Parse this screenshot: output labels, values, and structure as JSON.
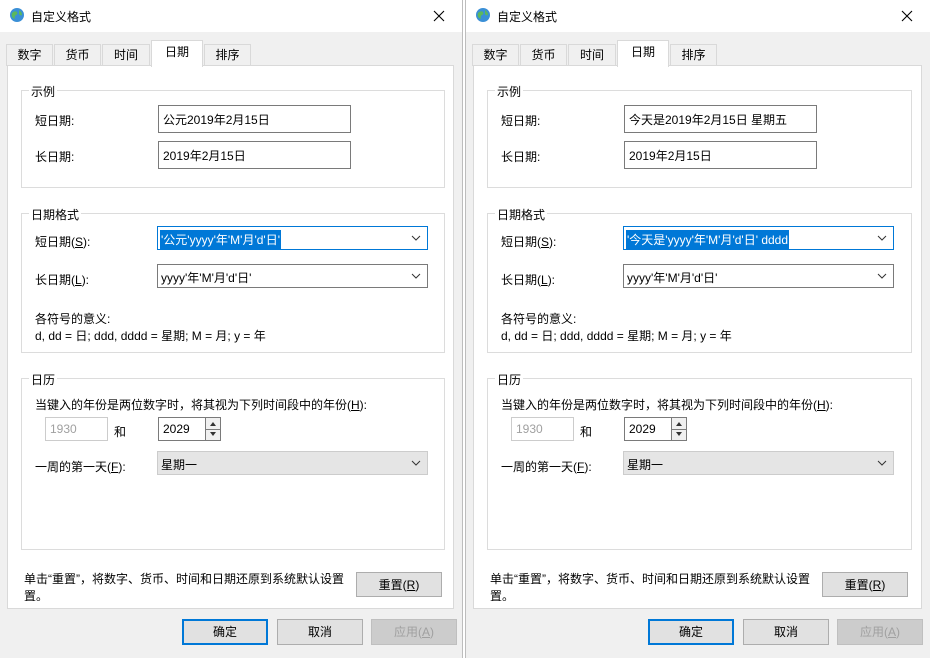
{
  "left": {
    "title": "自定义格式",
    "tabs": [
      "数字",
      "货币",
      "时间",
      "日期",
      "排序"
    ],
    "example": {
      "title": "示例",
      "short_label": "短日期:",
      "short_value": "公元2019年2月15日",
      "long_label": "长日期:",
      "long_value": "2019年2月15日"
    },
    "format": {
      "title": "日期格式",
      "short_label_pre": "短日期(",
      "short_label_key": "S",
      "short_label_post": "):",
      "short_value": "'公元'yyyy'年'M'月'd'日'",
      "long_label_pre": "长日期(",
      "long_label_key": "L",
      "long_label_post": "):",
      "long_value": "yyyy'年'M'月'd'日'",
      "meaning_title": "各符号的意义:",
      "meaning_text": "d, dd = 日;  ddd, dddd = 星期;  M = 月;  y = 年"
    },
    "calendar": {
      "title": "日历",
      "two_digit_pre": "当键入的年份是两位数字时，将其视为下列时间段中的年份(",
      "two_digit_key": "H",
      "two_digit_post": "):",
      "from_year": "1930",
      "and_label": "和",
      "to_year": "2029",
      "first_day_pre": "一周的第一天(",
      "first_day_key": "F",
      "first_day_post": "):",
      "first_day_value": "星期一"
    },
    "reset_text_line1": "单击“重置”，将数字、货币、时间和日期还原到系统默认设置",
    "reset_text_line2": "置。",
    "reset_pre": "重置(",
    "reset_key": "R",
    "reset_post": ")",
    "ok_label": "确定",
    "cancel_label": "取消",
    "apply_pre": "应用(",
    "apply_key": "A",
    "apply_post": ")"
  },
  "right": {
    "title": "自定义格式",
    "tabs": [
      "数字",
      "货币",
      "时间",
      "日期",
      "排序"
    ],
    "example": {
      "title": "示例",
      "short_label": "短日期:",
      "short_value": "今天是2019年2月15日 星期五",
      "long_label": "长日期:",
      "long_value": "2019年2月15日"
    },
    "format": {
      "title": "日期格式",
      "short_label_pre": "短日期(",
      "short_label_key": "S",
      "short_label_post": "):",
      "short_value": "'今天是'yyyy'年'M'月'd'日' dddd",
      "long_label_pre": "长日期(",
      "long_label_key": "L",
      "long_label_post": "):",
      "long_value": "yyyy'年'M'月'd'日'",
      "meaning_title": "各符号的意义:",
      "meaning_text": "d, dd = 日;  ddd, dddd = 星期;  M = 月;  y = 年"
    },
    "calendar": {
      "title": "日历",
      "two_digit_pre": "当键入的年份是两位数字时，将其视为下列时间段中的年份(",
      "two_digit_key": "H",
      "two_digit_post": "):",
      "from_year": "1930",
      "and_label": "和",
      "to_year": "2029",
      "first_day_pre": "一周的第一天(",
      "first_day_key": "F",
      "first_day_post": "):",
      "first_day_value": "星期一"
    },
    "reset_text_line1": "单击“重置”，将数字、货币、时间和日期还原到系统默认设置",
    "reset_text_line2": "置。",
    "reset_pre": "重置(",
    "reset_key": "R",
    "reset_post": ")",
    "ok_label": "确定",
    "cancel_label": "取消",
    "apply_pre": "应用(",
    "apply_key": "A",
    "apply_post": ")"
  },
  "colors": {
    "accent": "#0078d7",
    "dialog_bg": "#f0f0f0",
    "panel_bg": "#ffffff"
  }
}
